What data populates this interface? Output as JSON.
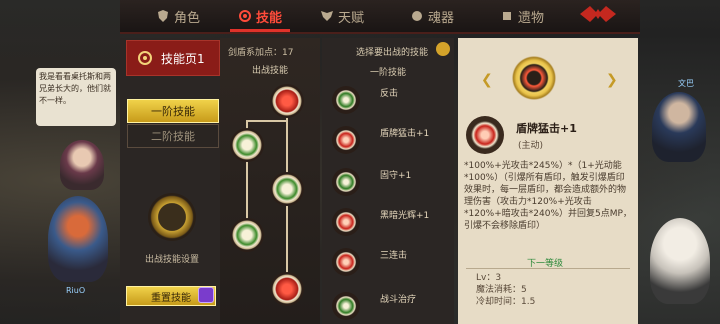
{
  "tabs": [
    {
      "label": "角色",
      "icon": "shield-icon",
      "active": false
    },
    {
      "label": "技能",
      "icon": "swirl-icon",
      "active": true
    },
    {
      "label": "天赋",
      "icon": "wings-icon",
      "active": false
    },
    {
      "label": "魂器",
      "icon": "orb-icon",
      "active": false
    },
    {
      "label": "遗物",
      "icon": "relic-icon",
      "active": false
    }
  ],
  "left_panel": {
    "page_title": "技能页1",
    "tier1": "一阶技能",
    "tier2": "二阶技能",
    "settings_label": "出战技能设置",
    "reset_label": "重置技能"
  },
  "skill_points": "剑盾系加点：17",
  "select_hint": "选择要出战的技能",
  "tree_header": "出战技能",
  "list_header": "一阶技能",
  "skills": [
    {
      "name": "反击",
      "color": "green"
    },
    {
      "name": "盾牌猛击+1",
      "color": "red"
    },
    {
      "name": "固守+1",
      "color": "green"
    },
    {
      "name": "黑暗光辉+1",
      "color": "red"
    },
    {
      "name": "三连击",
      "color": "red"
    },
    {
      "name": "战斗治疗",
      "color": "green"
    }
  ],
  "detail": {
    "name": "盾牌猛击+1",
    "type": "(主动)",
    "description": "*100%+光攻击*245%）*（1+光动能*100%）（引爆所有盾印，触发引爆盾印效果时，每一层盾印，都会造成额外的物理伤害（攻击力*120%+光攻击*120%+暗攻击*240%）并回复5点MP，引爆不会移除盾印）",
    "next_level": "下一等级",
    "level": "Lv：3",
    "mana_cost": "魔法消耗：5",
    "cooldown": "冷却时间：1.5"
  },
  "npc_dialog": "我是看看桌托斯和两兄弟长大的，他们就不一样。",
  "npc_name": "文巴",
  "player_name": "RiuO"
}
